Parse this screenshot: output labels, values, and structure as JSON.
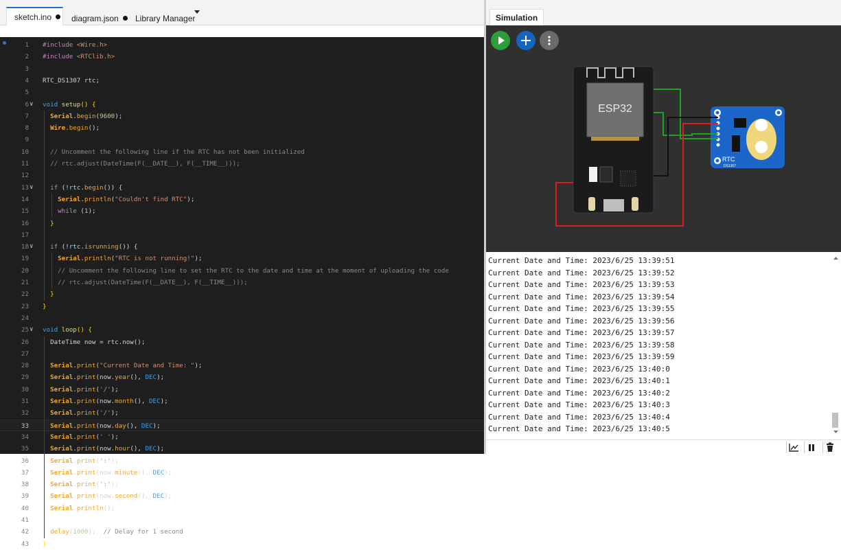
{
  "editor": {
    "tabs": [
      {
        "label": "sketch.ino",
        "modified": true
      },
      {
        "label": "diagram.json",
        "modified": true
      },
      {
        "label": "Library Manager",
        "has_dropdown": true
      }
    ],
    "active_line": 33,
    "lines": [
      [
        [
          "k",
          "#include "
        ],
        [
          "s",
          "<Wire.h>"
        ]
      ],
      [
        [
          "k",
          "#include "
        ],
        [
          "s",
          "<RTClib.h>"
        ]
      ],
      [],
      [
        [
          "",
          "RTC_DS1307 rtc;"
        ]
      ],
      [],
      [
        [
          "kw",
          "void "
        ],
        [
          "fn",
          "setup"
        ],
        [
          "y",
          "() {"
        ]
      ],
      [
        [
          "",
          "  "
        ],
        [
          "obj",
          "Serial"
        ],
        [
          "",
          "."
        ],
        [
          "mc",
          "begin"
        ],
        [
          "",
          "("
        ],
        [
          "n",
          "9600"
        ],
        [
          "",
          ");"
        ]
      ],
      [
        [
          "",
          "  "
        ],
        [
          "obj",
          "Wire"
        ],
        [
          "",
          "."
        ],
        [
          "mc",
          "begin"
        ],
        [
          "",
          "();"
        ]
      ],
      [],
      [
        [
          "",
          "  "
        ],
        [
          "cm",
          "// Uncomment the following line if the RTC has not been initialized"
        ]
      ],
      [
        [
          "",
          "  "
        ],
        [
          "cm",
          "// rtc.adjust(DateTime(F(__DATE__), F(__TIME__)));"
        ]
      ],
      [],
      [
        [
          "",
          "  "
        ],
        [
          "k",
          "if "
        ],
        [
          "",
          "(!"
        ],
        [
          "p",
          "rtc"
        ],
        [
          "",
          "."
        ],
        [
          "mc",
          "begin"
        ],
        [
          "",
          "()) {"
        ]
      ],
      [
        [
          "",
          "    "
        ],
        [
          "obj",
          "Serial"
        ],
        [
          "",
          "."
        ],
        [
          "mc",
          "println"
        ],
        [
          "",
          "("
        ],
        [
          "s",
          "\"Couldn't find RTC\""
        ],
        [
          "",
          ");"
        ]
      ],
      [
        [
          "",
          "    "
        ],
        [
          "k",
          "while "
        ],
        [
          "",
          "("
        ],
        [
          "n",
          "1"
        ],
        [
          "",
          ");"
        ]
      ],
      [
        [
          "",
          "  "
        ],
        [
          "y",
          "}"
        ]
      ],
      [],
      [
        [
          "",
          "  "
        ],
        [
          "k",
          "if "
        ],
        [
          "",
          "(!"
        ],
        [
          "p",
          "rtc"
        ],
        [
          "",
          "."
        ],
        [
          "mc",
          "isrunning"
        ],
        [
          "",
          "()) {"
        ]
      ],
      [
        [
          "",
          "    "
        ],
        [
          "obj",
          "Serial"
        ],
        [
          "",
          "."
        ],
        [
          "mc",
          "println"
        ],
        [
          "",
          "("
        ],
        [
          "s",
          "\"RTC is not running!\""
        ],
        [
          "",
          ");"
        ]
      ],
      [
        [
          "",
          "    "
        ],
        [
          "cm",
          "// Uncomment the following line to set the RTC to the date and time at the moment of uploading the code"
        ]
      ],
      [
        [
          "",
          "    "
        ],
        [
          "cm",
          "// rtc.adjust(DateTime(F(__DATE__), F(__TIME__)));"
        ]
      ],
      [
        [
          "",
          "  "
        ],
        [
          "y",
          "}"
        ]
      ],
      [
        [
          "y",
          "}"
        ]
      ],
      [],
      [
        [
          "kw",
          "void "
        ],
        [
          "fn",
          "loop"
        ],
        [
          "y",
          "() {"
        ]
      ],
      [
        [
          "",
          "  DateTime now = rtc.now();"
        ]
      ],
      [],
      [
        [
          "",
          "  "
        ],
        [
          "obj",
          "Serial"
        ],
        [
          "",
          "."
        ],
        [
          "mc",
          "print"
        ],
        [
          "",
          "("
        ],
        [
          "s",
          "\"Current Date and Time: \""
        ],
        [
          "",
          ");"
        ]
      ],
      [
        [
          "",
          "  "
        ],
        [
          "obj",
          "Serial"
        ],
        [
          "",
          "."
        ],
        [
          "mc",
          "print"
        ],
        [
          "",
          "(now."
        ],
        [
          "mc",
          "year"
        ],
        [
          "",
          "(), "
        ],
        [
          "dec",
          "DEC"
        ],
        [
          "",
          ");"
        ]
      ],
      [
        [
          "",
          "  "
        ],
        [
          "obj",
          "Serial"
        ],
        [
          "",
          "."
        ],
        [
          "mc",
          "print"
        ],
        [
          "",
          "("
        ],
        [
          "s",
          "'/'"
        ],
        [
          "",
          ");"
        ]
      ],
      [
        [
          "",
          "  "
        ],
        [
          "obj",
          "Serial"
        ],
        [
          "",
          "."
        ],
        [
          "mc",
          "print"
        ],
        [
          "",
          "(now."
        ],
        [
          "mc",
          "month"
        ],
        [
          "",
          "(), "
        ],
        [
          "dec",
          "DEC"
        ],
        [
          "",
          ");"
        ]
      ],
      [
        [
          "",
          "  "
        ],
        [
          "obj",
          "Serial"
        ],
        [
          "",
          "."
        ],
        [
          "mc",
          "print"
        ],
        [
          "",
          "("
        ],
        [
          "s",
          "'/'"
        ],
        [
          "",
          ");"
        ]
      ],
      [
        [
          "",
          "  "
        ],
        [
          "obj",
          "Serial"
        ],
        [
          "",
          "."
        ],
        [
          "mc",
          "print"
        ],
        [
          "",
          "(now."
        ],
        [
          "mc",
          "day"
        ],
        [
          "",
          "(), "
        ],
        [
          "dec",
          "DEC"
        ],
        [
          "",
          ");"
        ]
      ],
      [
        [
          "",
          "  "
        ],
        [
          "obj",
          "Serial"
        ],
        [
          "",
          "."
        ],
        [
          "mc",
          "print"
        ],
        [
          "",
          "("
        ],
        [
          "s",
          "' '"
        ],
        [
          "",
          ");"
        ]
      ],
      [
        [
          "",
          "  "
        ],
        [
          "obj",
          "Serial"
        ],
        [
          "",
          "."
        ],
        [
          "mc",
          "print"
        ],
        [
          "",
          "(now."
        ],
        [
          "mc",
          "hour"
        ],
        [
          "",
          "(), "
        ],
        [
          "dec",
          "DEC"
        ],
        [
          "",
          ");"
        ]
      ],
      [
        [
          "",
          "  "
        ],
        [
          "obj",
          "Serial"
        ],
        [
          "",
          "."
        ],
        [
          "mc",
          "print"
        ],
        [
          "",
          "("
        ],
        [
          "s",
          "':'"
        ],
        [
          "",
          ");"
        ]
      ],
      [
        [
          "",
          "  "
        ],
        [
          "obj",
          "Serial"
        ],
        [
          "",
          "."
        ],
        [
          "mc",
          "print"
        ],
        [
          "",
          "(now."
        ],
        [
          "mc",
          "minute"
        ],
        [
          "",
          "(), "
        ],
        [
          "dec",
          "DEC"
        ],
        [
          "",
          ");"
        ]
      ],
      [
        [
          "",
          "  "
        ],
        [
          "obj",
          "Serial"
        ],
        [
          "",
          "."
        ],
        [
          "mc",
          "print"
        ],
        [
          "",
          "("
        ],
        [
          "s",
          "':'"
        ],
        [
          "",
          ");"
        ]
      ],
      [
        [
          "",
          "  "
        ],
        [
          "obj",
          "Serial"
        ],
        [
          "",
          "."
        ],
        [
          "mc",
          "print"
        ],
        [
          "",
          "(now."
        ],
        [
          "mc",
          "second"
        ],
        [
          "",
          "(), "
        ],
        [
          "dec",
          "DEC"
        ],
        [
          "",
          ");"
        ]
      ],
      [
        [
          "",
          "  "
        ],
        [
          "obj",
          "Serial"
        ],
        [
          "",
          "."
        ],
        [
          "mc",
          "println"
        ],
        [
          "",
          "();"
        ]
      ],
      [],
      [
        [
          "",
          "  "
        ],
        [
          "mc",
          "delay"
        ],
        [
          "",
          "("
        ],
        [
          "n",
          "1000"
        ],
        [
          "",
          ");  "
        ],
        [
          "cm",
          "// Delay for 1 second"
        ]
      ],
      [
        [
          "y",
          "}"
        ]
      ]
    ]
  },
  "simulation": {
    "tab_label": "Simulation",
    "buttons": [
      {
        "name": "play-button",
        "color": "#2e9e3a"
      },
      {
        "name": "add-part-button",
        "color": "#1565c0"
      },
      {
        "name": "more-button",
        "color": "#6b6b6b"
      }
    ],
    "esp32_label": "ESP32",
    "rtc_label": "RTC",
    "rtc_sublabel": "DS1307"
  },
  "serial_monitor": {
    "lines": [
      "Current Date and Time: 2023/6/25 13:39:51",
      "Current Date and Time: 2023/6/25 13:39:52",
      "Current Date and Time: 2023/6/25 13:39:53",
      "Current Date and Time: 2023/6/25 13:39:54",
      "Current Date and Time: 2023/6/25 13:39:55",
      "Current Date and Time: 2023/6/25 13:39:56",
      "Current Date and Time: 2023/6/25 13:39:57",
      "Current Date and Time: 2023/6/25 13:39:58",
      "Current Date and Time: 2023/6/25 13:39:59",
      "Current Date and Time: 2023/6/25 13:40:0",
      "Current Date and Time: 2023/6/25 13:40:1",
      "Current Date and Time: 2023/6/25 13:40:2",
      "Current Date and Time: 2023/6/25 13:40:3",
      "Current Date and Time: 2023/6/25 13:40:4",
      "Current Date and Time: 2023/6/25 13:40:5"
    ],
    "footer_buttons": [
      "plotter-icon",
      "pause-icon",
      "trash-icon"
    ]
  }
}
